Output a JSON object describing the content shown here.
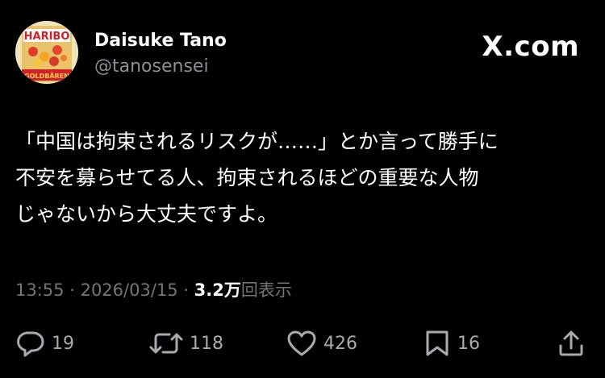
{
  "author": {
    "name": "Daisuke Tano",
    "handle": "@tanosensei",
    "avatar_label": "HARIBO GOLDBÄREN"
  },
  "brand": "X.com",
  "tweet": {
    "lines": [
      "「中国は拘束されるリスクが……」とか言って勝手に",
      "不安を募らせてる人、拘束されるほどの重要な人物",
      "じゃないから大丈夫ですよ。"
    ]
  },
  "meta": {
    "time": "13:55",
    "date": "2026/03/15",
    "views_count": "3.2万",
    "views_label": "回表示"
  },
  "actions": {
    "replies": "19",
    "reposts": "118",
    "likes": "426",
    "bookmarks": "16"
  },
  "icons": {
    "reply": "reply-icon",
    "repost": "repost-icon",
    "like": "heart-icon",
    "bookmark": "bookmark-icon",
    "share": "share-icon"
  },
  "colors": {
    "background": "#000000",
    "text": "#ffffff",
    "muted": "#71767b",
    "icon": "#a7abb0"
  }
}
